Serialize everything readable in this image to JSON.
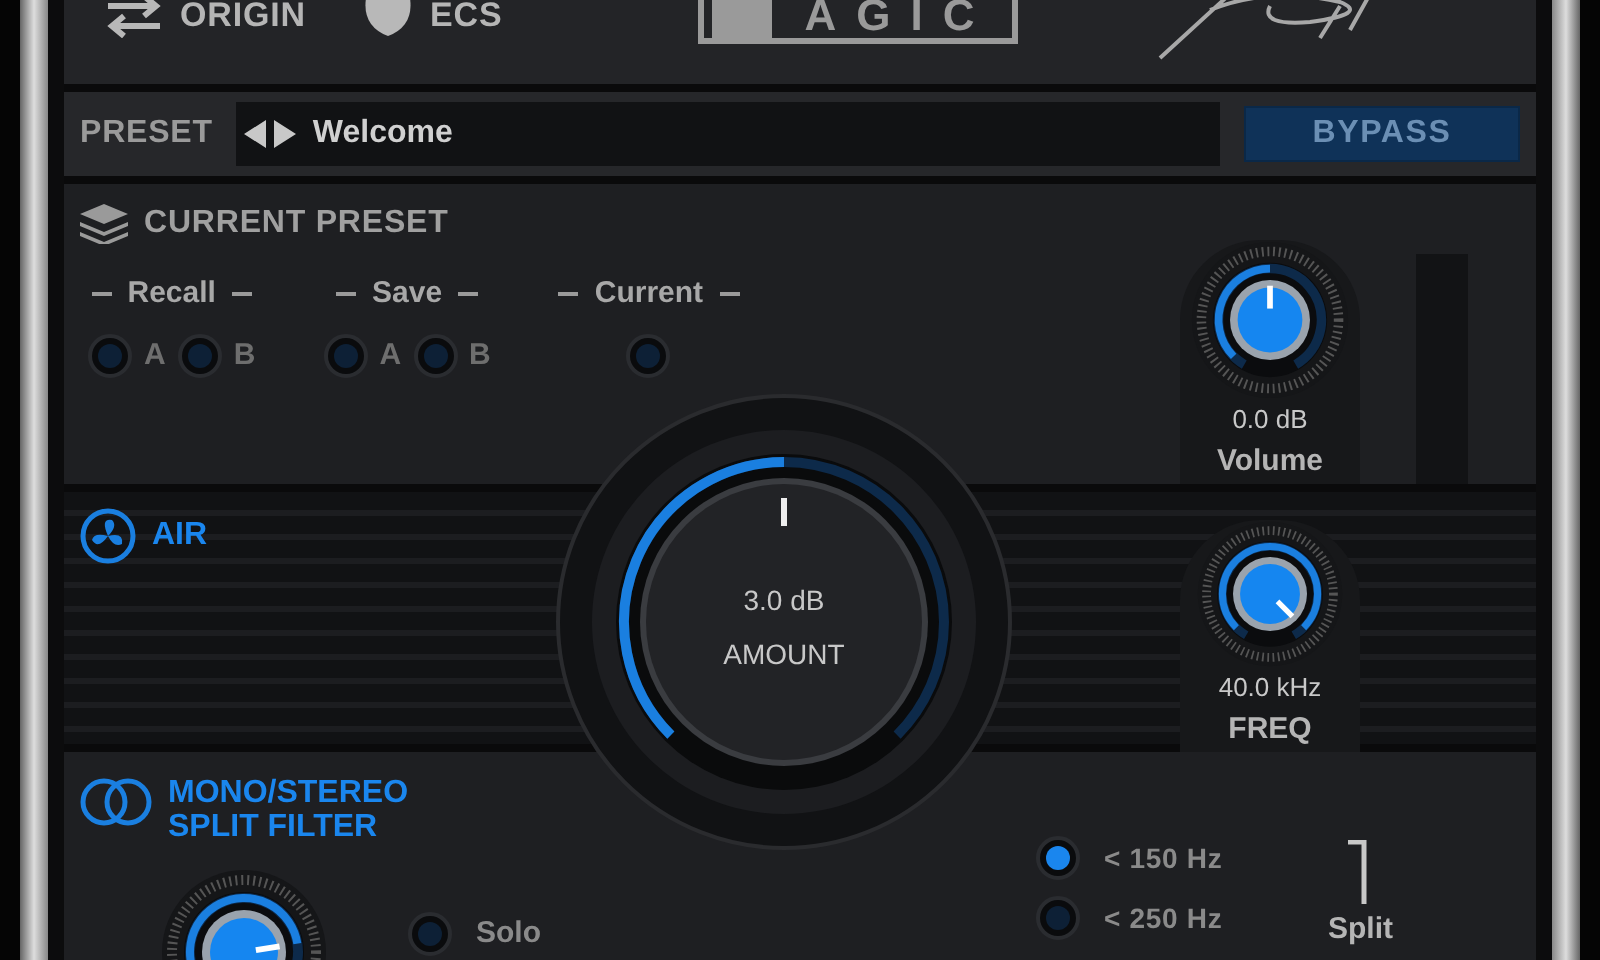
{
  "header": {
    "items": [
      {
        "kind": "swap",
        "label": "ORIGIN"
      },
      {
        "kind": "mask",
        "label": "ECS"
      }
    ],
    "logo": "AGIC"
  },
  "preset": {
    "label": "PRESET",
    "name": "Welcome",
    "bypass": {
      "label": "BYPASS",
      "on": false
    }
  },
  "current_preset": {
    "title": "CURRENT PRESET",
    "groups": [
      {
        "label": "Recall",
        "buttons": [
          {
            "label": "A",
            "on": false
          },
          {
            "label": "B",
            "on": false
          }
        ]
      },
      {
        "label": "Save",
        "buttons": [
          {
            "label": "A",
            "on": false
          },
          {
            "label": "B",
            "on": false
          }
        ]
      },
      {
        "label": "Current",
        "buttons": [
          {
            "on": false
          }
        ]
      }
    ],
    "volume": {
      "value": "0.0 dB",
      "label": "Volume",
      "level": 0.5
    }
  },
  "air": {
    "title": "AIR",
    "amount": {
      "value": "3.0 dB",
      "label": "AMOUNT",
      "level": 0.5
    },
    "freq": {
      "value": "40.0 kHz",
      "label": "FREQ",
      "level": 1
    }
  },
  "split": {
    "title": [
      "MONO/STEREO",
      "SPLIT FILTER"
    ],
    "knob": {
      "level": 0.8
    },
    "solo": {
      "label": "Solo",
      "on": false
    },
    "options": [
      {
        "label": "< 150 Hz",
        "selected": true
      },
      {
        "label": "< 250 Hz",
        "selected": false
      }
    ],
    "split_label": "Split"
  }
}
